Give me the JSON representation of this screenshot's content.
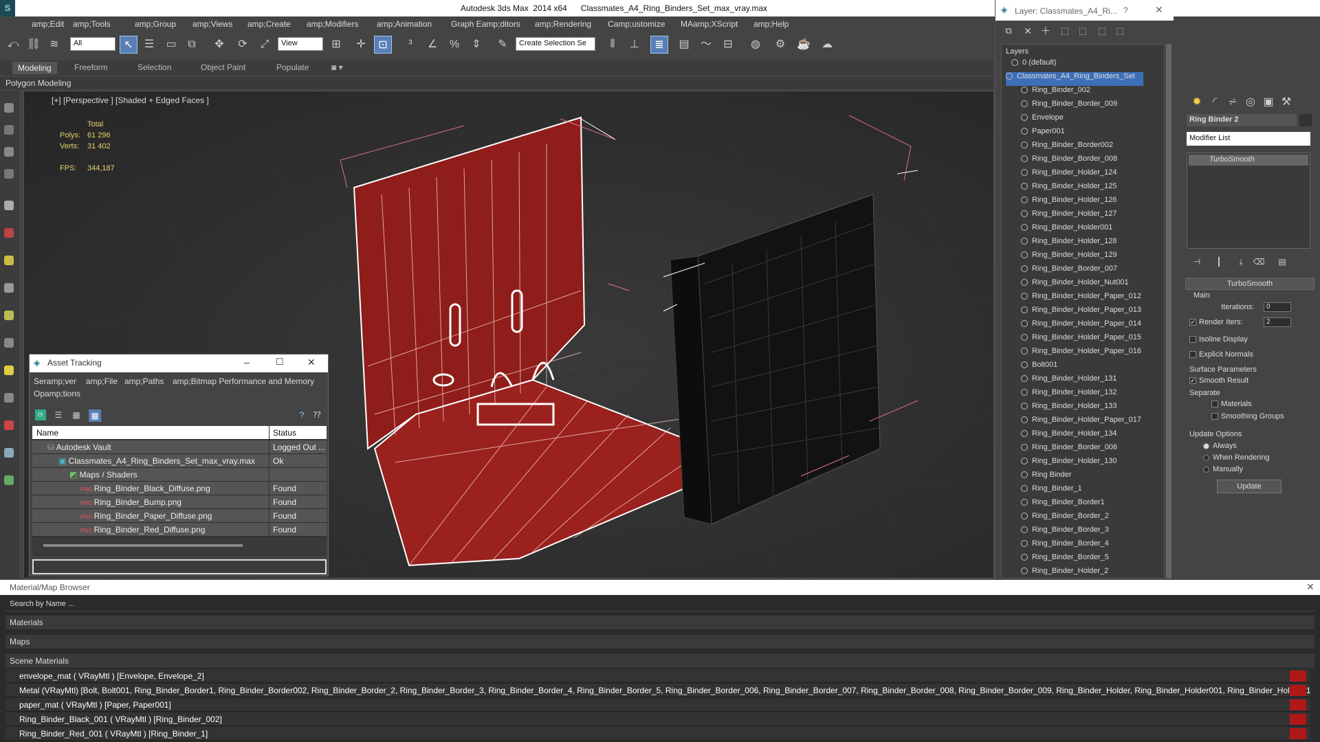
{
  "title": {
    "app": "Autodesk 3ds Max  2014 x64",
    "file": "Classmates_A4_Ring_Binders_Set_max_vray.max"
  },
  "menu": [
    "amp;Edit",
    "amp;Tools",
    "amp;Group",
    "amp;Views",
    "amp;Create",
    "amp;Modifiers",
    "amp;Animation",
    "Graph Eamp;ditors",
    "amp;Rendering",
    "Camp;ustomize",
    "MAamp;XScript",
    "amp;Help"
  ],
  "toolbar": {
    "filter": "All",
    "refcoord": "View",
    "selection_set_placeholder": "Create Selection Se"
  },
  "ribbon": {
    "tabs": [
      "Modeling",
      "Freeform",
      "Selection",
      "Object Paint",
      "Populate"
    ],
    "sub": "Polygon Modeling"
  },
  "viewport": {
    "label": "[+] [Perspective ] [Shaded + Edged Faces ]",
    "stats": {
      "total": "Total",
      "polys_label": "Polys:",
      "polys": "61 296",
      "verts_label": "Verts:",
      "verts": "31 402",
      "fps_label": "FPS:",
      "fps": "344,187"
    }
  },
  "asset_tracking": {
    "title": "Asset Tracking",
    "menu": [
      "Seramp;ver",
      "amp;File",
      "amp;Paths",
      "amp;Bitmap Performance and Memory",
      "Opamp;tions"
    ],
    "columns": [
      "Name",
      "Status"
    ],
    "rows": [
      {
        "name": "Autodesk Vault",
        "status": "Logged Out ..."
      },
      {
        "name": "Classmates_A4_Ring_Binders_Set_max_vray.max",
        "status": "Ok"
      },
      {
        "name": "Maps / Shaders",
        "status": ""
      },
      {
        "name": "Ring_Binder_Black_Diffuse.png",
        "status": "Found"
      },
      {
        "name": "Ring_Binder_Bump.png",
        "status": "Found"
      },
      {
        "name": "Ring_Binder_Paper_Diffuse.png",
        "status": "Found"
      },
      {
        "name": "Ring_Binder_Red_Diffuse.png",
        "status": "Found"
      }
    ]
  },
  "layer_manager": {
    "title": "Layer: Classmates_A4_Ri...",
    "help": "?",
    "header": "Layers",
    "items": [
      "0 (default)",
      "Classmates_A4_Ring_Binders_Set",
      "Ring_Binder_002",
      "Ring_Binder_Border_009",
      "Envelope",
      "Paper001",
      "Ring_Binder_Border002",
      "Ring_Binder_Border_008",
      "Ring_Binder_Holder_124",
      "Ring_Binder_Holder_125",
      "Ring_Binder_Holder_126",
      "Ring_Binder_Holder_127",
      "Ring_Binder_Holder001",
      "Ring_Binder_Holder_128",
      "Ring_Binder_Holder_129",
      "Ring_Binder_Border_007",
      "Ring_Binder_Holder_Nut001",
      "Ring_Binder_Holder_Paper_012",
      "Ring_Binder_Holder_Paper_013",
      "Ring_Binder_Holder_Paper_014",
      "Ring_Binder_Holder_Paper_015",
      "Ring_Binder_Holder_Paper_016",
      "Bolt001",
      "Ring_Binder_Holder_131",
      "Ring_Binder_Holder_132",
      "Ring_Binder_Holder_133",
      "Ring_Binder_Holder_Paper_017",
      "Ring_Binder_Holder_134",
      "Ring_Binder_Border_006",
      "Ring_Binder_Holder_130",
      "Ring Binder",
      "Ring_Binder_1",
      "Ring_Binder_Border1",
      "Ring_Binder_Border_2",
      "Ring_Binder_Border_3",
      "Ring_Binder_Border_4",
      "Ring_Binder_Border_5",
      "Ring_Binder_Holder_2"
    ]
  },
  "command_panel": {
    "object_name": "Ring Binder 2",
    "modifier_list": "Modifier List",
    "stack_item": "TurboSmooth",
    "rollout": "TurboSmooth",
    "main": "Main",
    "iterations_label": "Iterations:",
    "iterations": "0",
    "render_iters_label": "Render Iters:",
    "render_iters": "2",
    "isoline": "Isoline Display",
    "explicit": "Explicit Normals",
    "surface": "Surface Parameters",
    "smooth_result": "Smooth Result",
    "separate": "Separate",
    "materials": "Materials",
    "smoothing_groups": "Smoothing Groups",
    "update_options": "Update Options",
    "always": "Always",
    "when_rendering": "When Rendering",
    "manually": "Manually",
    "update": "Update"
  },
  "material_browser": {
    "title": "Material/Map Browser",
    "search": "Search by Name ...",
    "groups": [
      "Materials",
      "Maps",
      "Scene Materials"
    ],
    "scene_materials": [
      "envelope_mat  ( VRayMtl ) [Envelope, Envelope_2]",
      "Metal (VRayMtl) [Bolt, Bolt001, Ring_Binder_Border1, Ring_Binder_Border002, Ring_Binder_Border_2, Ring_Binder_Border_3, Ring_Binder_Border_4, Ring_Binder_Border_5, Ring_Binder_Border_006, Ring_Binder_Border_007, Ring_Binder_Border_008, Ring_Binder_Border_009, Ring_Binder_Holder, Ring_Binder_Holder001, Ring_Binder_Holder_1, Ring_Binder_Hold...",
      "paper_mat  ( VRayMtl ) [Paper, Paper001]",
      "Ring_Binder_Black_001  ( VRayMtl ) [Ring_Binder_002]",
      "Ring_Binder_Red_001  ( VRayMtl ) [Ring_Binder_1]"
    ]
  },
  "colors": {
    "accent": "#5a7fb5",
    "binder_red": "#8f1d1a",
    "selection": "#3d6fb8"
  }
}
